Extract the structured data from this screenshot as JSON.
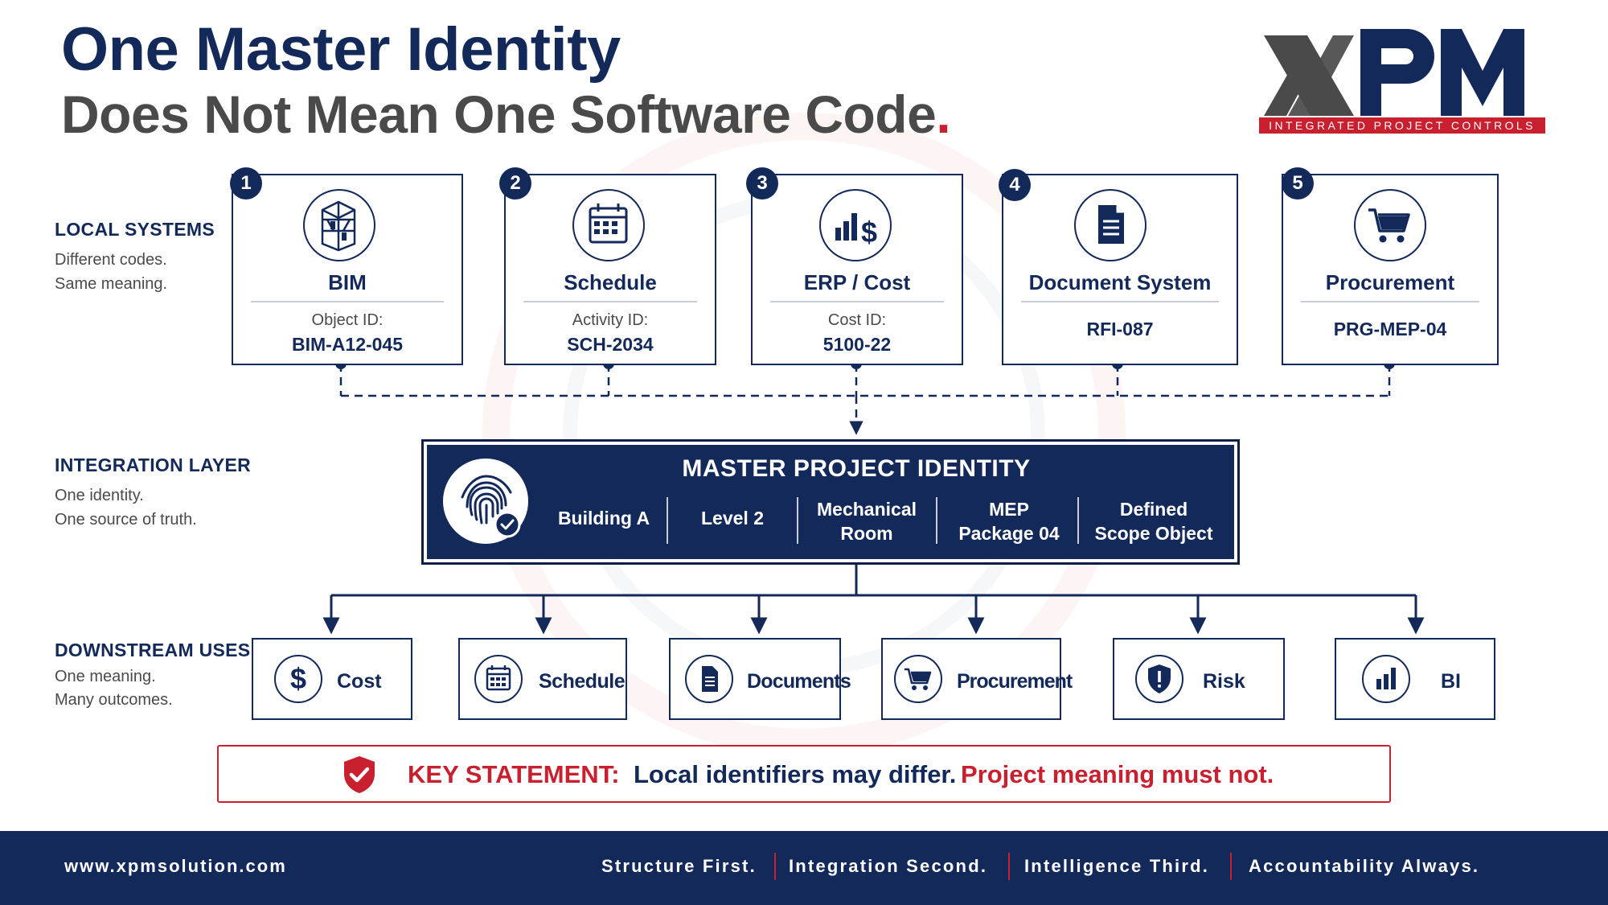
{
  "colors": {
    "navy": "#13295a",
    "red": "#c8202e",
    "gray": "#4a4a4a",
    "divider": "#c9ccd4"
  },
  "title": {
    "line1": "One Master Identity",
    "line2": "Does Not Mean One Software Code",
    "line2_end": "."
  },
  "logo": {
    "wordmark": "XPM",
    "tagline": "INTEGRATED PROJECT CONTROLS"
  },
  "sections": {
    "local": {
      "heading": "LOCAL SYSTEMS",
      "line1": "Different codes.",
      "line2": "Same meaning."
    },
    "integration": {
      "heading": "INTEGRATION LAYER",
      "line1": "One identity.",
      "line2": "One source of truth."
    },
    "downstream": {
      "heading": "DOWNSTREAM USES",
      "line1": "One meaning.",
      "line2": "Many outcomes."
    }
  },
  "systems": [
    {
      "number": "1",
      "title": "BIM",
      "label": "Object ID:",
      "code": "BIM-A12-045",
      "icon": "building-icon"
    },
    {
      "number": "2",
      "title": "Schedule",
      "label": "Activity ID:",
      "code": "SCH-2034",
      "icon": "calendar-icon"
    },
    {
      "number": "3",
      "title": "ERP / Cost",
      "label": "Cost ID:",
      "code": "5100-22",
      "icon": "cost-chart-icon"
    },
    {
      "number": "4",
      "title": "Document System",
      "label": "",
      "code": "RFI-087",
      "icon": "document-icon"
    },
    {
      "number": "5",
      "title": "Procurement",
      "label": "",
      "code": "PRG-MEP-04",
      "icon": "cart-icon"
    }
  ],
  "master": {
    "title": "MASTER PROJECT IDENTITY",
    "items": [
      {
        "line1": "Building A",
        "line2": ""
      },
      {
        "line1": "Level 2",
        "line2": ""
      },
      {
        "line1": "Mechanical",
        "line2": "Room"
      },
      {
        "line1": "MEP",
        "line2": "Package 04"
      },
      {
        "line1": "Defined",
        "line2": "Scope Object"
      }
    ]
  },
  "downstream": [
    {
      "label": "Cost",
      "icon": "dollar-icon"
    },
    {
      "label": "Schedule",
      "icon": "calendar-icon"
    },
    {
      "label": "Documents",
      "icon": "document-icon"
    },
    {
      "label": "Procurement",
      "icon": "cart-icon"
    },
    {
      "label": "Risk",
      "icon": "shield-alert-icon"
    },
    {
      "label": "BI",
      "icon": "bar-chart-icon"
    }
  ],
  "key_statement": {
    "label": "KEY STATEMENT:",
    "text1": "Local identifiers may differ.",
    "text2": "Project meaning must not."
  },
  "footer": {
    "url": "www.xpmsolution.com",
    "taglines": [
      "Structure First.",
      "Integration Second.",
      "Intelligence Third.",
      "Accountability Always."
    ]
  }
}
